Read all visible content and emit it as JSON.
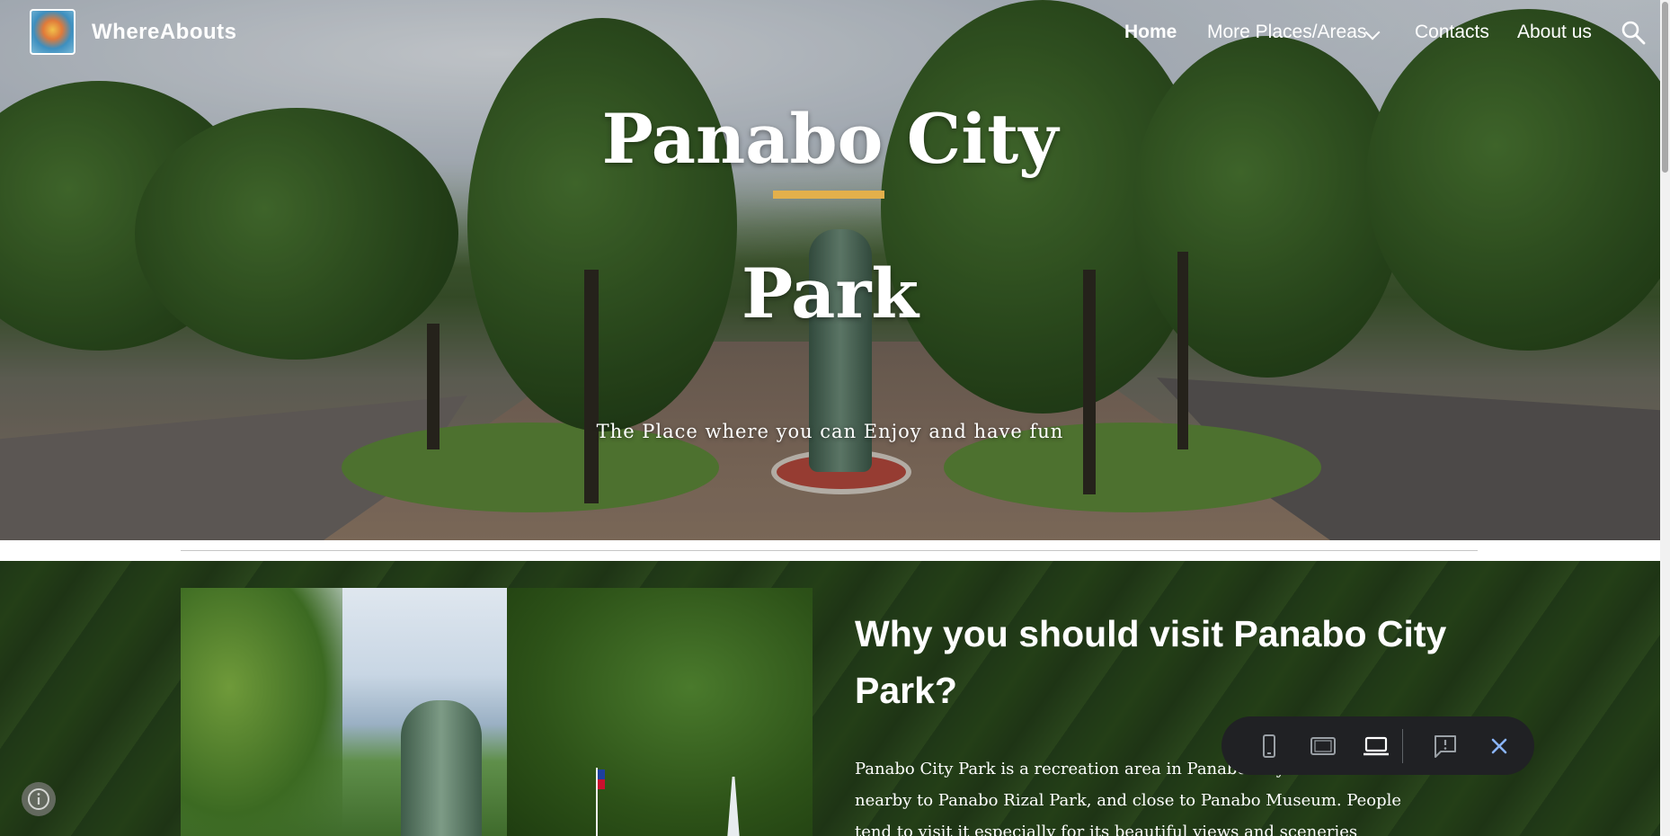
{
  "nav": {
    "site_title": "WhereAbouts",
    "logo_icon": "site-logo",
    "items": [
      {
        "label": "Home",
        "active": true
      },
      {
        "label": "More Places/Areas"
      },
      {
        "label": "Contacts"
      },
      {
        "label": "About us"
      }
    ],
    "dropdown_icon": "chevron-down-icon",
    "search_icon": "search-icon"
  },
  "hero": {
    "title_line1": "Panabo City",
    "title_line2": "Park",
    "subtitle": "The Place where you can Enjoy and have fun",
    "accent_color": "#e3b04b"
  },
  "section": {
    "title": "Why you should visit Panabo City Park?",
    "body": "Panabo City Park is a recreation area in Panabo City. It is situated nearby to Panabo Rizal Park, and close to Panabo Museum. People tend to visit it especially for its beautiful views and sceneries"
  },
  "toolbar": {
    "buttons": [
      "phone-preview-icon",
      "tablet-preview-icon",
      "laptop-preview-icon",
      "report-icon",
      "close-icon"
    ],
    "active_color": "#8ab4f8"
  },
  "info_icon": "info-icon"
}
